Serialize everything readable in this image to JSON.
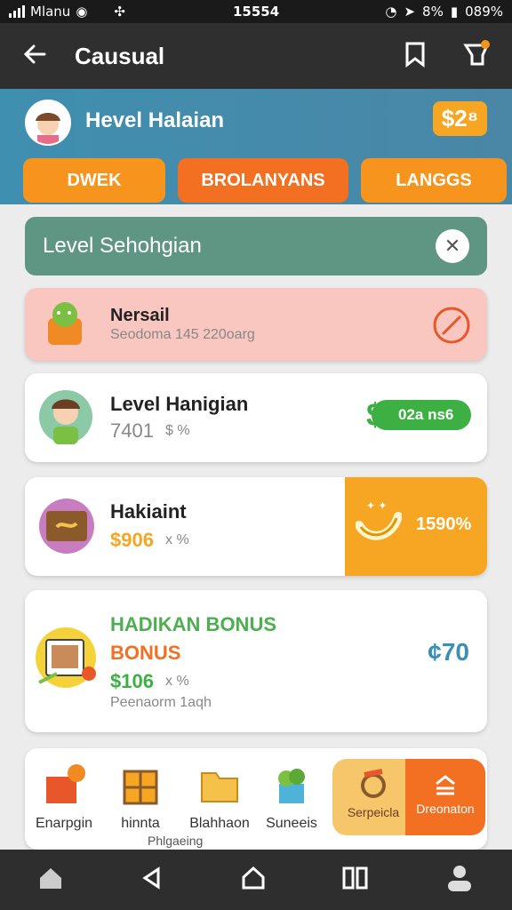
{
  "status_bar": {
    "carrier": "Mlanu",
    "time": "15554",
    "battery_small": "8%",
    "battery": "089%"
  },
  "app_bar": {
    "title": "Causual"
  },
  "hero": {
    "name": "Hevel Halaian",
    "balance": "$2⁸"
  },
  "tabs": [
    "DWEK",
    "BROLANYANS",
    "LANGGS"
  ],
  "banner": {
    "label": "Level  Sehohgian",
    "close_symbol": "✕"
  },
  "cards": {
    "c1": {
      "title": "Nersail",
      "subtitle": "Seodoma 145 220oarg"
    },
    "c2": {
      "title": "Level Hanigian",
      "value": "7401",
      "suffix": "$ %",
      "badge_prefix": "$",
      "badge": "02a ns6"
    },
    "c3": {
      "title": "Hakiaint",
      "value": "$906",
      "suffix": "x %",
      "side_value": "1590%"
    },
    "c4": {
      "title1": "HADIKAN BONUS",
      "title2": "BONUS",
      "value": "$106",
      "suffix": "x %",
      "note": "Peenaorm 1aqh",
      "amount": "¢70"
    },
    "c5": {
      "items": [
        "Enarpgin",
        "hinnta",
        "Blahhaon",
        "Suneeis"
      ],
      "sub": "Phlgaeing",
      "btn1": "Serpeicla",
      "btn2": "Dreonaton"
    }
  },
  "colors": {
    "orange": "#f7941d",
    "teal": "#4a8fb0",
    "green": "#3cb043",
    "dark": "#2e2e2e"
  }
}
